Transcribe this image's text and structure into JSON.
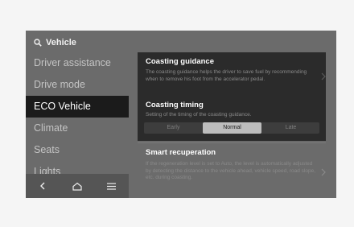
{
  "header": {
    "search_icon": "search-icon",
    "title": "Vehicle"
  },
  "sidebar": {
    "items": [
      {
        "label": "Driver assistance",
        "active": false
      },
      {
        "label": "Drive mode",
        "active": false
      },
      {
        "label": "ECO Vehicle",
        "active": true
      },
      {
        "label": "Climate",
        "active": false
      },
      {
        "label": "Seats",
        "active": false
      },
      {
        "label": "Lights",
        "active": false
      }
    ]
  },
  "bottom_nav": {
    "icons": [
      "back-arrow-icon",
      "home-icon",
      "menu-icon"
    ]
  },
  "settings": {
    "coasting_guidance": {
      "title": "Coasting guidance",
      "description": "The coasting guidance helps the driver to save fuel by recommending when to remove his foot from the accelerator pedal."
    },
    "coasting_timing": {
      "title": "Coasting timing",
      "description": "Setting of the timing of the coasting guidance.",
      "options": [
        "Early",
        "Normal",
        "Late"
      ],
      "selected": "Normal"
    },
    "smart_recuperation": {
      "title": "Smart recuperation",
      "description": "If the regeneration level is set to Auto, the level is automatically adjusted by detecting the distance to the vehicle ahead, vehicle speed, road slope, etc. during coasting."
    }
  },
  "colors": {
    "screen_bg": "#6b6b6b",
    "panel_bg": "#2b2b2b",
    "active_item_bg": "#1b1b1b",
    "selected_option_bg": "#bdbdbd"
  }
}
